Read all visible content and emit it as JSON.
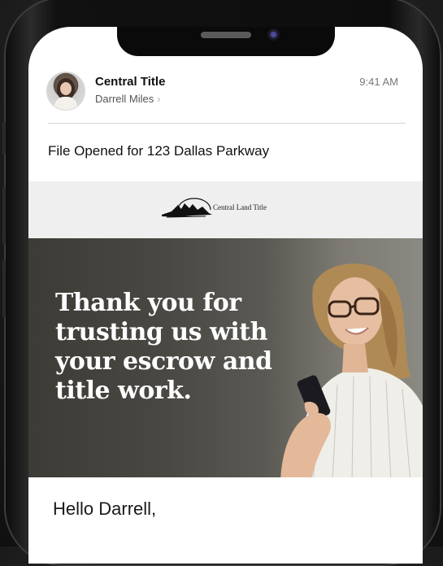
{
  "email": {
    "sender_name": "Central Title",
    "recipient": "Darrell Miles",
    "recipient_chevron": "›",
    "time": "9:41 AM",
    "subject": "File Opened for 123 Dallas Parkway"
  },
  "logo": {
    "text": "Central Land Title"
  },
  "hero": {
    "headline": "Thank you for trusting us with your escrow and title work."
  },
  "body": {
    "greeting": "Hello Darrell,"
  },
  "colors": {
    "hero_text": "#ffffff",
    "logo_band": "#efefef",
    "background": "#101010"
  },
  "icons": [
    "avatar",
    "chevron-right-icon",
    "mountain-logo-icon",
    "camera-icon",
    "speaker-icon"
  ]
}
